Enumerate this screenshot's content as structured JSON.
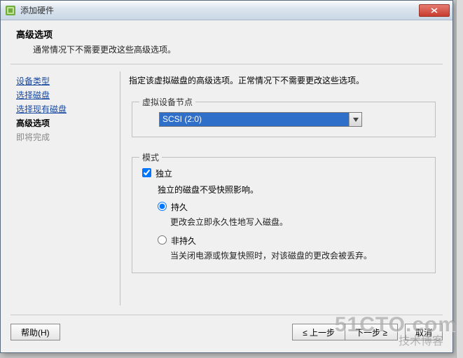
{
  "window": {
    "title": "添加硬件"
  },
  "header": {
    "title": "高级选项",
    "desc": "通常情况下不需要更改这些高级选项。"
  },
  "sidebar": {
    "items": [
      {
        "label": "设备类型",
        "state": "link"
      },
      {
        "label": "选择磁盘",
        "state": "link"
      },
      {
        "label": "选择现有磁盘",
        "state": "link"
      },
      {
        "label": "高级选项",
        "state": "current"
      },
      {
        "label": "即将完成",
        "state": "disabled"
      }
    ]
  },
  "main": {
    "intro": "指定该虚拟磁盘的高级选项。正常情况下不需要更改这些选项。",
    "node_group": {
      "legend": "虚拟设备节点",
      "selected": "SCSI (2:0)"
    },
    "mode_group": {
      "legend": "模式",
      "independent": {
        "label": "独立",
        "checked": true,
        "desc": "独立的磁盘不受快照影响。"
      },
      "persistent": {
        "label": "持久",
        "selected": true,
        "desc": "更改会立即永久性地写入磁盘。"
      },
      "nonpersistent": {
        "label": "非持久",
        "selected": false,
        "desc": "当关闭电源或恢复快照时，对该磁盘的更改会被丢弃。"
      }
    }
  },
  "footer": {
    "help": "帮助(H)",
    "back": "≤ 上一步",
    "next": "下一步 ≥",
    "cancel": "取消"
  },
  "watermark": {
    "big": "51CTO.com",
    "small": "技术博客"
  }
}
